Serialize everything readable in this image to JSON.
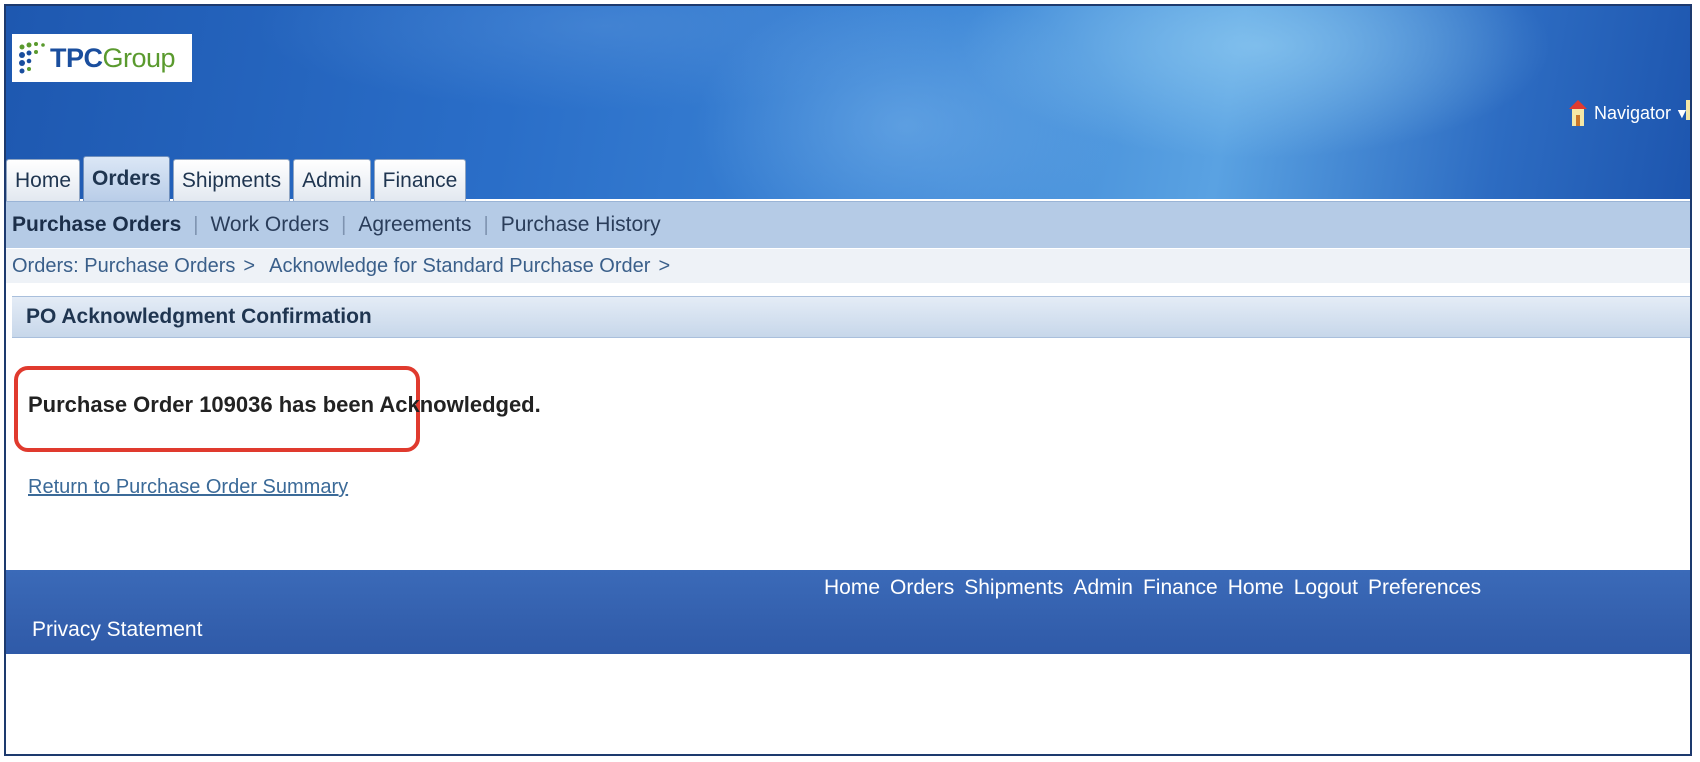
{
  "logo": {
    "brand_bold": "TPC",
    "brand_light": "Group"
  },
  "header": {
    "navigator_label": "Navigator",
    "navigator_arrow": "▼"
  },
  "tabs": [
    {
      "label": "Home",
      "active": false
    },
    {
      "label": "Orders",
      "active": true
    },
    {
      "label": "Shipments",
      "active": false
    },
    {
      "label": "Admin",
      "active": false
    },
    {
      "label": "Finance",
      "active": false
    }
  ],
  "subnav": [
    {
      "label": "Purchase Orders",
      "active": true
    },
    {
      "label": "Work Orders",
      "active": false
    },
    {
      "label": "Agreements",
      "active": false
    },
    {
      "label": "Purchase History",
      "active": false
    }
  ],
  "subnav_separator": "|",
  "breadcrumb": [
    {
      "label": "Orders: Purchase Orders"
    },
    {
      "label": "Acknowledge for Standard Purchase Order"
    }
  ],
  "breadcrumb_separator": ">",
  "section": {
    "title": "PO Acknowledgment Confirmation"
  },
  "message": {
    "text": "Purchase Order 109036 has been Acknowledged."
  },
  "links": {
    "return_label": "Return to Purchase Order Summary"
  },
  "footer": {
    "links": [
      "Home",
      "Orders",
      "Shipments",
      "Admin",
      "Finance",
      "Home",
      "Logout",
      "Preferences"
    ],
    "privacy_label": "Privacy Statement"
  },
  "colors": {
    "brand_blue": "#1a4e9e",
    "brand_green": "#5a9a2e",
    "highlight_red": "#e03a2e",
    "footer_blue": "#3565b2",
    "link_blue": "#3b6a98"
  },
  "icons": {
    "navigator": "home-icon"
  }
}
